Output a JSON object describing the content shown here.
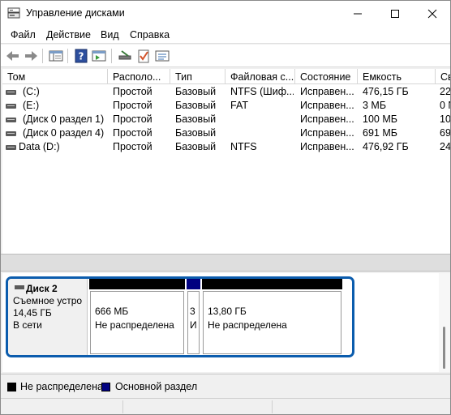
{
  "window": {
    "title": "Управление дисками",
    "icons": [
      "disk-management-app-icon",
      "minimize-icon",
      "maximize-icon",
      "close-icon"
    ]
  },
  "menu": [
    "Файл",
    "Действие",
    "Вид",
    "Справка"
  ],
  "toolbar_icons": [
    "back-arrow-icon",
    "forward-arrow-icon",
    "console-tree-icon",
    "help-icon",
    "console-view-icon",
    "connect-drive-icon",
    "checkmark-properties-icon",
    "list-view-icon"
  ],
  "table": {
    "columns": [
      "Том",
      "Располо...",
      "Тип",
      "Файловая с...",
      "Состояние",
      "Емкость",
      "Св"
    ],
    "rows": [
      {
        "tom": "(C:)",
        "layout": "Простой",
        "type": "Базовый",
        "fs": "NTFS (Шиф...",
        "status": "Исправен...",
        "capacity": "476,15 ГБ",
        "free": "22"
      },
      {
        "tom": "(E:)",
        "layout": "Простой",
        "type": "Базовый",
        "fs": "FAT",
        "status": "Исправен...",
        "capacity": "3 МБ",
        "free": "0 N"
      },
      {
        "tom": "(Диск 0 раздел 1)",
        "layout": "Простой",
        "type": "Базовый",
        "fs": "",
        "status": "Исправен...",
        "capacity": "100 МБ",
        "free": "10"
      },
      {
        "tom": "(Диск 0 раздел 4)",
        "layout": "Простой",
        "type": "Базовый",
        "fs": "",
        "status": "Исправен...",
        "capacity": "691 МБ",
        "free": "69"
      },
      {
        "tom": "Data (D:)",
        "layout": "Простой",
        "type": "Базовый",
        "fs": "NTFS",
        "status": "Исправен...",
        "capacity": "476,92 ГБ",
        "free": "24"
      }
    ]
  },
  "disk": {
    "name": "Диск 2",
    "type": "Съемное устро",
    "size": "14,45 ГБ",
    "state": "В сети",
    "partitions": [
      {
        "size": "666 МБ",
        "status": "Не распределена",
        "color": "#000000"
      },
      {
        "size": "3",
        "status": "И",
        "color": "#000080"
      },
      {
        "size": "13,80 ГБ",
        "status": "Не распределена",
        "color": "#000000"
      }
    ]
  },
  "legend": [
    {
      "label": "Не распределена",
      "color": "#000000"
    },
    {
      "label": "Основной раздел",
      "color": "#000080"
    }
  ],
  "colors": {
    "selection_border": "#0b5cad",
    "primary_partition": "#000080",
    "unallocated": "#000000"
  }
}
